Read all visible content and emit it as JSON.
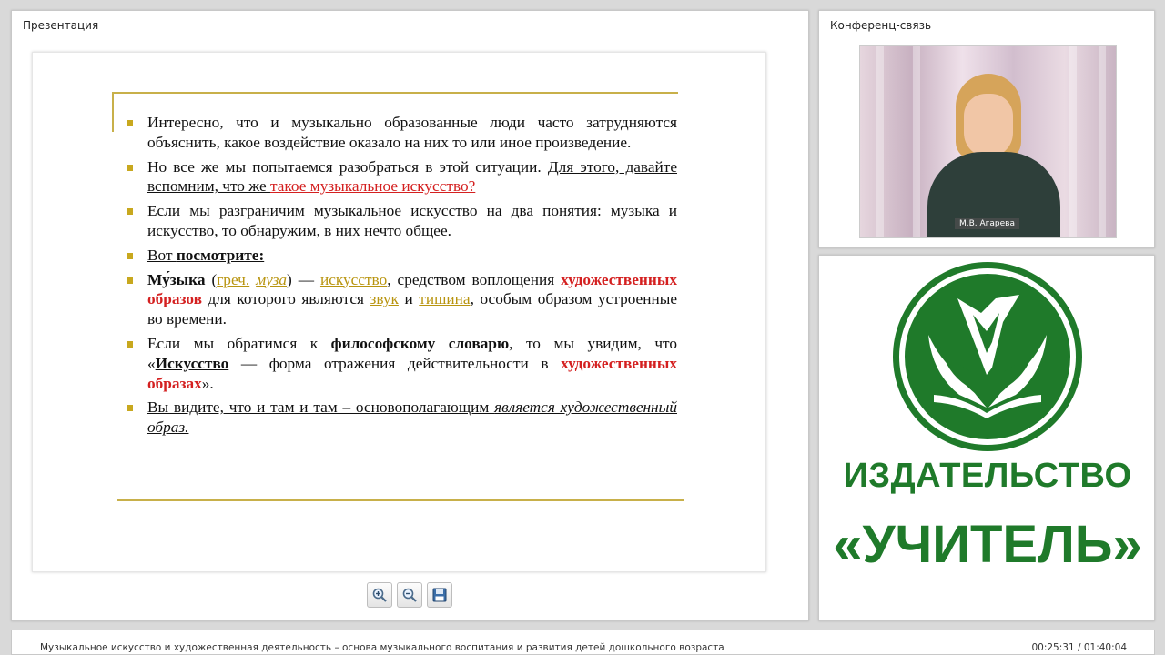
{
  "presentation": {
    "title": "Презентация",
    "slide": {
      "bullets": [
        {
          "parts": [
            {
              "t": "Интересно, что и музыкально образованные люди часто затрудняются объяснить, какое воздействие оказало на них то или иное произведение."
            }
          ]
        },
        {
          "parts": [
            {
              "t": "Но все же мы попытаемся разобраться в этой ситуации. "
            },
            {
              "t": "Для этого, давайте вспомним, что же ",
              "s": "u"
            },
            {
              "t": "такое музыкальное искусство?",
              "s": "u red"
            }
          ]
        },
        {
          "parts": [
            {
              "t": "Если мы разграничим "
            },
            {
              "t": "музыкальное искусство",
              "s": "u"
            },
            {
              "t": " на два понятия: музыка и искусство, то обнаружим, в них нечто общее."
            }
          ]
        },
        {
          "parts": [
            {
              "t": "Вот ",
              "s": "u"
            },
            {
              "t": "посмотрите:",
              "s": "u b"
            }
          ]
        },
        {
          "parts": [
            {
              "t": "Му́зыка",
              "s": "b"
            },
            {
              "t": " ("
            },
            {
              "t": "греч.",
              "s": "u gold"
            },
            {
              "t": " "
            },
            {
              "t": "муза",
              "s": "u gold i"
            },
            {
              "t": ") — "
            },
            {
              "t": "искусство",
              "s": "u gold"
            },
            {
              "t": ", средством воплощения "
            },
            {
              "t": "художественных образов",
              "s": "redb"
            },
            {
              "t": " для которого являются "
            },
            {
              "t": "звук",
              "s": "u gold"
            },
            {
              "t": " и "
            },
            {
              "t": "тишина",
              "s": "u gold"
            },
            {
              "t": ", особым образом устроенные во времени."
            }
          ]
        },
        {
          "parts": [
            {
              "t": "Если мы обратимся к "
            },
            {
              "t": "философскому словарю",
              "s": "b"
            },
            {
              "t": ", то мы увидим, что «"
            },
            {
              "t": "Искусство",
              "s": "u b"
            },
            {
              "t": " — форма отражения действительности в "
            },
            {
              "t": "художественных образах",
              "s": "redb"
            },
            {
              "t": "»."
            }
          ]
        },
        {
          "parts": [
            {
              "t": "Вы видите, что и там и там – основополагающим ",
              "s": "u"
            },
            {
              "t": "является художественный образ.",
              "s": "u i"
            }
          ]
        }
      ]
    },
    "toolbar": {
      "zoom_in": "zoom-in-icon",
      "zoom_out": "zoom-out-icon",
      "save": "save-icon"
    }
  },
  "conference": {
    "title": "Конференц-связь",
    "participant_name": "М.В. Агарева"
  },
  "logo": {
    "line1": "ИЗДАТЕЛЬСТВО",
    "line2": "«УЧИТЕЛЬ»",
    "color": "#1f7a2a"
  },
  "footer": {
    "title": "Музыкальное искусство и художественная деятельность – основа музыкального воспитания и развития детей дошкольного возраста",
    "time": "00:25:31 / 01:40:04"
  },
  "colors": {
    "accent_gold": "#c8b04a",
    "bullet": "#c8a81e",
    "red": "#d42020",
    "brand_green": "#1f7a2a"
  }
}
